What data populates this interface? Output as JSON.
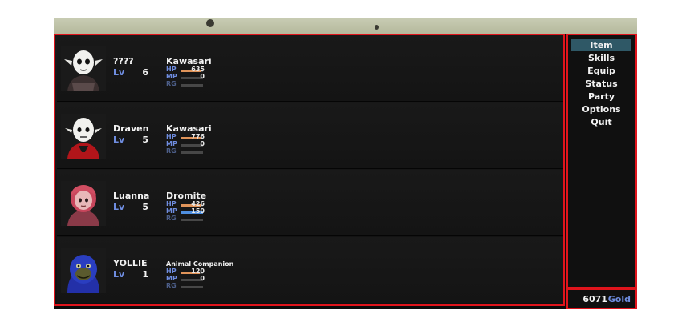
{
  "party": [
    {
      "name": "????",
      "level_label": "Lv",
      "level": "6",
      "class": "Kawasari",
      "hp_label": "HP",
      "hp": "635",
      "hp_fill": 0.9,
      "mp_label": "MP",
      "mp": "0",
      "mp_fill": 0,
      "rg_label": "RG",
      "rg_fill": 0
    },
    {
      "name": "Draven",
      "level_label": "Lv",
      "level": "5",
      "class": "Kawasari",
      "hp_label": "HP",
      "hp": "776",
      "hp_fill": 0.9,
      "mp_label": "MP",
      "mp": "0",
      "mp_fill": 0,
      "rg_label": "RG",
      "rg_fill": 0
    },
    {
      "name": "Luanna",
      "level_label": "Lv",
      "level": "5",
      "class": "Dromite",
      "hp_label": "HP",
      "hp": "426",
      "hp_fill": 0.9,
      "mp_label": "MP",
      "mp": "150",
      "mp_fill": 1,
      "rg_label": "RG",
      "rg_fill": 0
    },
    {
      "name": "YOLLIE",
      "level_label": "Lv",
      "level": "1",
      "class": "Animal Companion",
      "hp_label": "HP",
      "hp": "120",
      "hp_fill": 0.85,
      "mp_label": "MP",
      "mp": "0",
      "mp_fill": 0,
      "rg_label": "RG",
      "rg_fill": 0
    }
  ],
  "menu": {
    "items": [
      "Item",
      "Skills",
      "Equip",
      "Status",
      "Party",
      "Options",
      "Quit"
    ],
    "selected": "Item"
  },
  "gold": {
    "amount": "6071",
    "unit": "Gold"
  },
  "colors": {
    "border": "#e0141c",
    "hp_gauge": "#e0945a",
    "mp_gauge": "#4f8fe0",
    "label_blue": "#6f8de0",
    "menu_highlight": "#2f5866"
  }
}
